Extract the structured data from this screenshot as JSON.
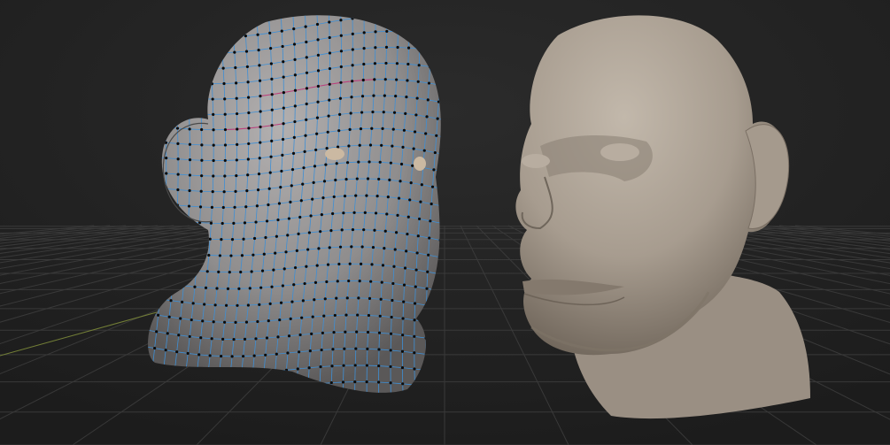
{
  "scene": {
    "background_color": "#232323",
    "grid_color": "#3c3c3c",
    "grid_axis_color": "#7d8a3a",
    "left_model": {
      "type": "head-sculpt",
      "display": "wireframe-over-shaded",
      "surface_color": "#8f8d8d",
      "wire_color": "#3d8fd6",
      "seam_color": "#c0407a",
      "vertex_color": "#0a0a0a"
    },
    "right_model": {
      "type": "head-sculpt",
      "display": "shaded",
      "surface_color": "#a79c8f"
    }
  }
}
